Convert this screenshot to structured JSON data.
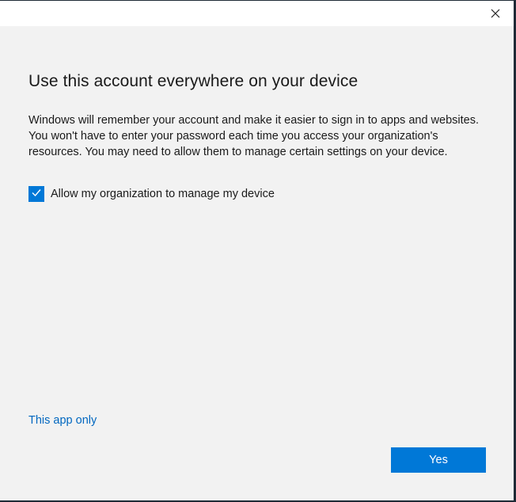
{
  "dialog": {
    "title": "Use this account everywhere on your device",
    "description": "Windows will remember your account and make it easier to sign in to apps and websites. You won't have to enter your password each time you access your organization's resources. You may need to allow them to manage certain settings on your device.",
    "checkbox": {
      "label": "Allow my organization to manage my device",
      "checked": true
    },
    "link_label": "This app only",
    "yes_label": "Yes"
  },
  "colors": {
    "accent": "#0078d7",
    "link": "#0067c0",
    "background": "#f2f2f2"
  }
}
